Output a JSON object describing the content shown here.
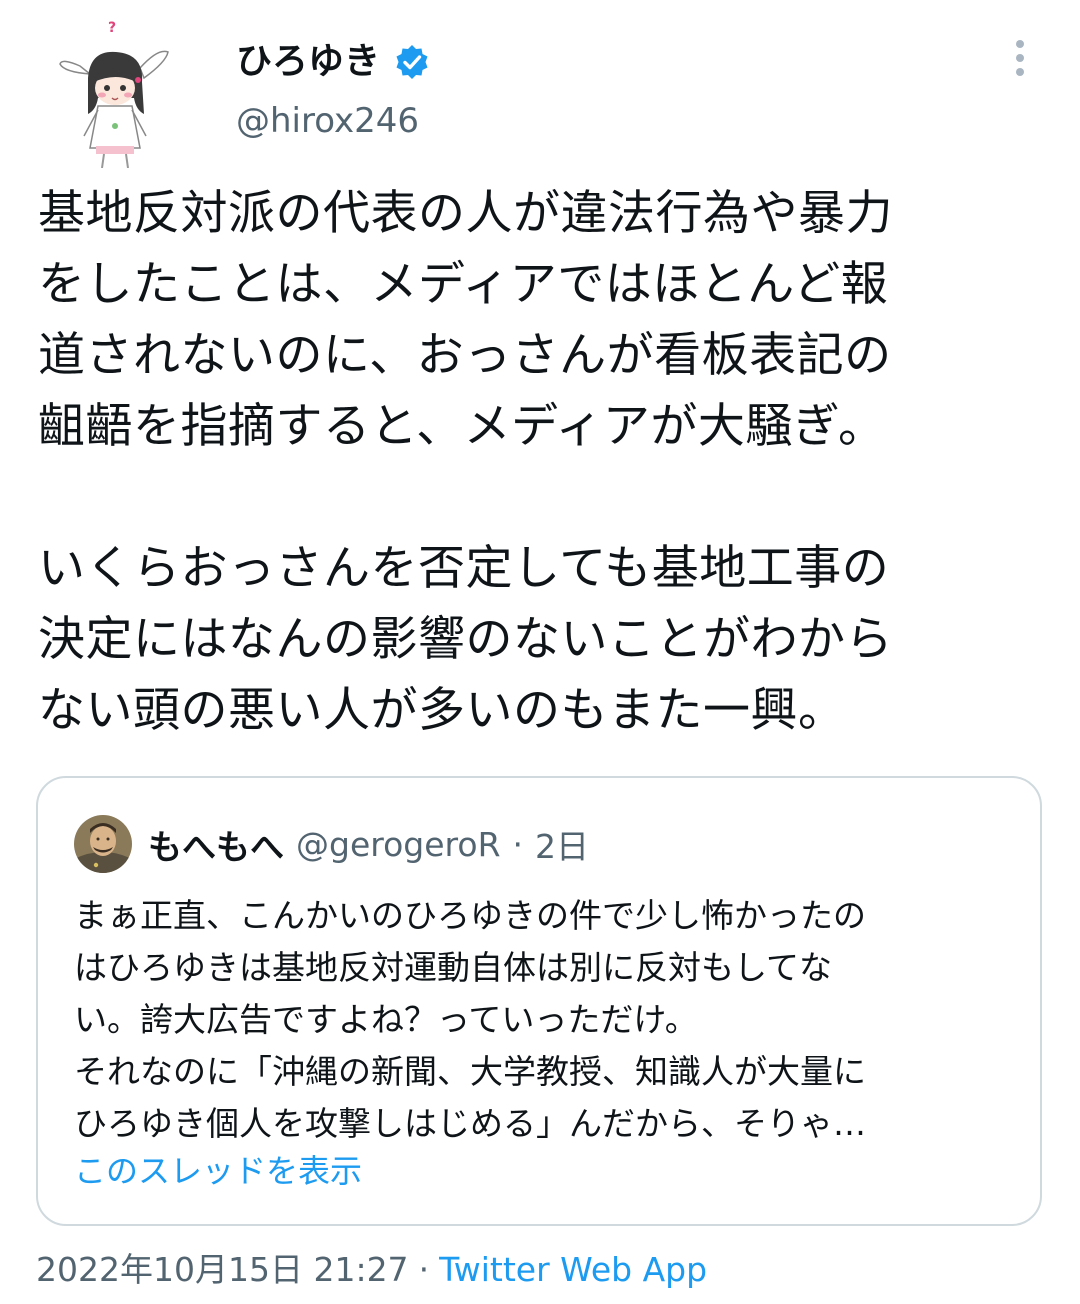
{
  "user": {
    "display_name": "ひろゆき",
    "handle": "@hirox246",
    "verified": true,
    "avatar_icon": "bunny-girl-avatar-icon"
  },
  "tweet": {
    "paragraphs": [
      [
        "基地反対派の代表の人が違法行為や暴力",
        "をしたことは、メディアではほとんど報",
        "道されないのに、おっさんが看板表記の",
        "齟齬を指摘すると、メディアが大騒ぎ。"
      ],
      [
        "いくらおっさんを否定しても基地工事の",
        "決定にはなんの影響のないことがわから",
        "ない頭の悪い人が多いのもまた一興。"
      ]
    ]
  },
  "quoted": {
    "display_name": "もへもへ",
    "handle": "@gerogeroR",
    "separator": "·",
    "time": "2日",
    "lines": [
      "まぁ正直、こんかいのひろゆきの件で少し怖かったの",
      "はひろゆきは基地反対運動自体は別に反対もしてな",
      "い。誇大広告ですよね？っていっただけ。",
      "それなのに「沖縄の新聞、大学教授、知識人が大量に",
      "ひろゆき個人を攻撃しはじめる」んだから、そりゃ…"
    ],
    "show_thread": "このスレッドを表示"
  },
  "footer": {
    "datetime": "2022年10月15日 21:27",
    "separator": "·",
    "source": "Twitter Web App"
  },
  "colors": {
    "text": "#0f1419",
    "secondary": "#536471",
    "link": "#1d9bf0",
    "border": "#cfd9de"
  }
}
